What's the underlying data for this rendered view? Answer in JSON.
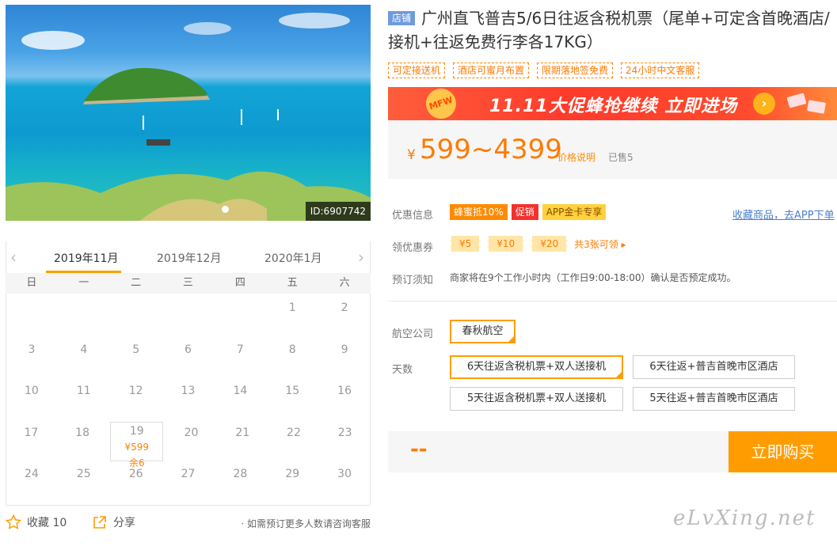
{
  "hero": {
    "id_label": "ID:6907742"
  },
  "calendar": {
    "prev_arrow": "‹",
    "next_arrow": "›",
    "months": [
      "2019年11月",
      "2019年12月",
      "2020年1月"
    ],
    "weekdays": [
      "日",
      "一",
      "二",
      "三",
      "四",
      "五",
      "六"
    ],
    "rows": [
      [
        "",
        "",
        "",
        "",
        "",
        "1",
        "2"
      ],
      [
        "3",
        "4",
        "5",
        "6",
        "7",
        "8",
        "9"
      ],
      [
        "10",
        "11",
        "12",
        "13",
        "14",
        "15",
        "16"
      ],
      [
        "17",
        "18",
        "19",
        "20",
        "21",
        "22",
        "23"
      ],
      [
        "24",
        "25",
        "26",
        "27",
        "28",
        "29",
        "30"
      ]
    ],
    "selected_day": {
      "day": "19",
      "price": "¥599",
      "stock": "余6"
    }
  },
  "footer_left": {
    "favorite": "收藏 10",
    "share": "分享",
    "note": "· 如需预订更多人数请咨询客服"
  },
  "product": {
    "shop_badge": "店铺",
    "title": "广州直飞普吉5/6日往返含税机票（尾单+可定含首晚酒店/接机+往返免费行李各17KG）",
    "tags": [
      "可定接送机",
      "酒店可蜜月布置",
      "限期落地签免费",
      "24小时中文客服"
    ]
  },
  "banner": {
    "badge": "MFW",
    "text": "11.11大促蜂抢继续 立即进场",
    "go": "›"
  },
  "price": {
    "currency": "¥",
    "range": "599~4399",
    "explain": "价格说明",
    "sold": "已售5"
  },
  "promotions": {
    "label": "优惠信息",
    "badges": [
      "蜂蜜抵10%",
      "促销",
      "APP金卡专享"
    ],
    "favorite_link": "收藏商品，去APP下单"
  },
  "coupons": {
    "label": "领优惠券",
    "items": [
      "¥5",
      "¥10",
      "¥20"
    ],
    "more": "共3张可领 ▸"
  },
  "booking_notice": {
    "label": "预订须知",
    "text": "商家将在9个工作小时内（工作日9:00-18:00）确认是否预定成功。"
  },
  "airline": {
    "label": "航空公司",
    "options": [
      "春秋航空"
    ]
  },
  "days": {
    "label": "天数",
    "options": [
      "6天往返含税机票+双人送接机",
      "6天往返+普吉首晚市区酒店",
      "5天往返含税机票+双人送接机",
      "5天往返+普吉首晚市区酒店"
    ]
  },
  "buy": {
    "total": "--",
    "button": "立即购买"
  },
  "watermark": "eLvXing.net",
  "colors": {
    "accent": "#ff9d00",
    "price": "#ff7a00",
    "link": "#4a7fd1"
  }
}
